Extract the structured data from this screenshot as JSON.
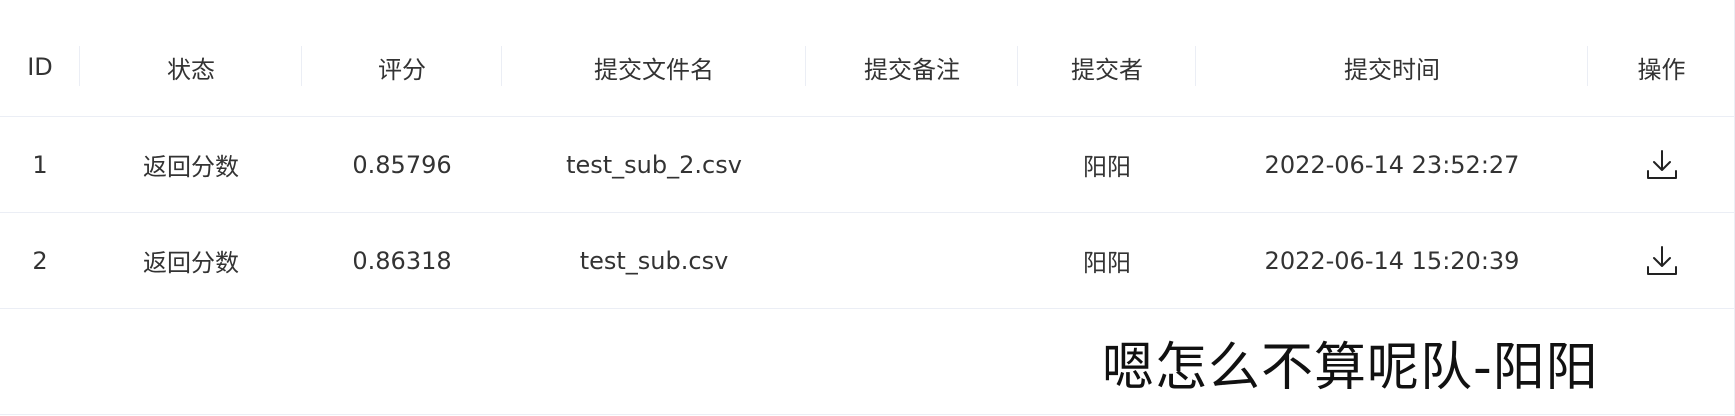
{
  "table": {
    "headers": {
      "id": "ID",
      "status": "状态",
      "score": "评分",
      "file": "提交文件名",
      "note": "提交备注",
      "user": "提交者",
      "time": "提交时间",
      "op": "操作"
    },
    "rows": [
      {
        "id": "1",
        "status": "返回分数",
        "score": "0.85796",
        "file": "test_sub_2.csv",
        "note": "",
        "user": "阳阳",
        "time": "2022-06-14 23:52:27",
        "action_icon": "download-icon"
      },
      {
        "id": "2",
        "status": "返回分数",
        "score": "0.86318",
        "file": "test_sub.csv",
        "note": "",
        "user": "阳阳",
        "time": "2022-06-14 15:20:39",
        "action_icon": "download-icon"
      }
    ]
  },
  "caption": {
    "text": "嗯怎么不算呢队-阳阳"
  },
  "colors": {
    "text": "#333333",
    "border": "#ebeef5",
    "caption": "#111111"
  }
}
